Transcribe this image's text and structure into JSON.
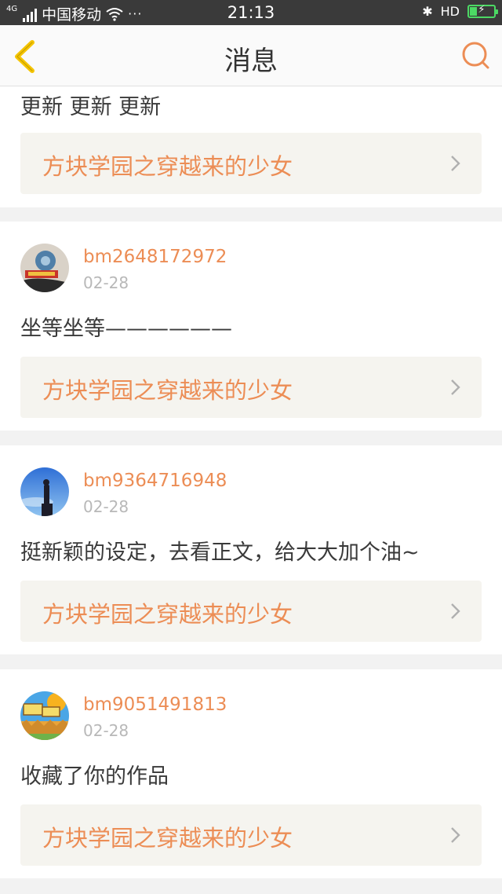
{
  "status_bar": {
    "network": "4G",
    "carrier": "中国移动",
    "dots": "···",
    "time": "21:13",
    "bluetooth": "✱",
    "hd": "HD"
  },
  "nav": {
    "title": "消息",
    "back_icon": "chevron-left",
    "search_icon": "search"
  },
  "colors": {
    "accent": "#ec8d55",
    "back_arrow": "#f5c400",
    "link_bg": "#f5f4ef",
    "text": "#3a3a3a",
    "date": "#b8b8b8"
  },
  "items": [
    {
      "comment": "更新 更新 更新",
      "work_title": "方块学园之穿越来的少女"
    },
    {
      "username": "bm2648172972",
      "date": "02-28",
      "comment": "坐等坐等——————",
      "work_title": "方块学园之穿越来的少女"
    },
    {
      "username": "bm9364716948",
      "date": "02-28",
      "comment": "挺新颖的设定，去看正文，给大大加个油~",
      "work_title": "方块学园之穿越来的少女"
    },
    {
      "username": "bm9051491813",
      "date": "02-28",
      "comment": "收藏了你的作品",
      "work_title": "方块学园之穿越来的少女"
    }
  ]
}
